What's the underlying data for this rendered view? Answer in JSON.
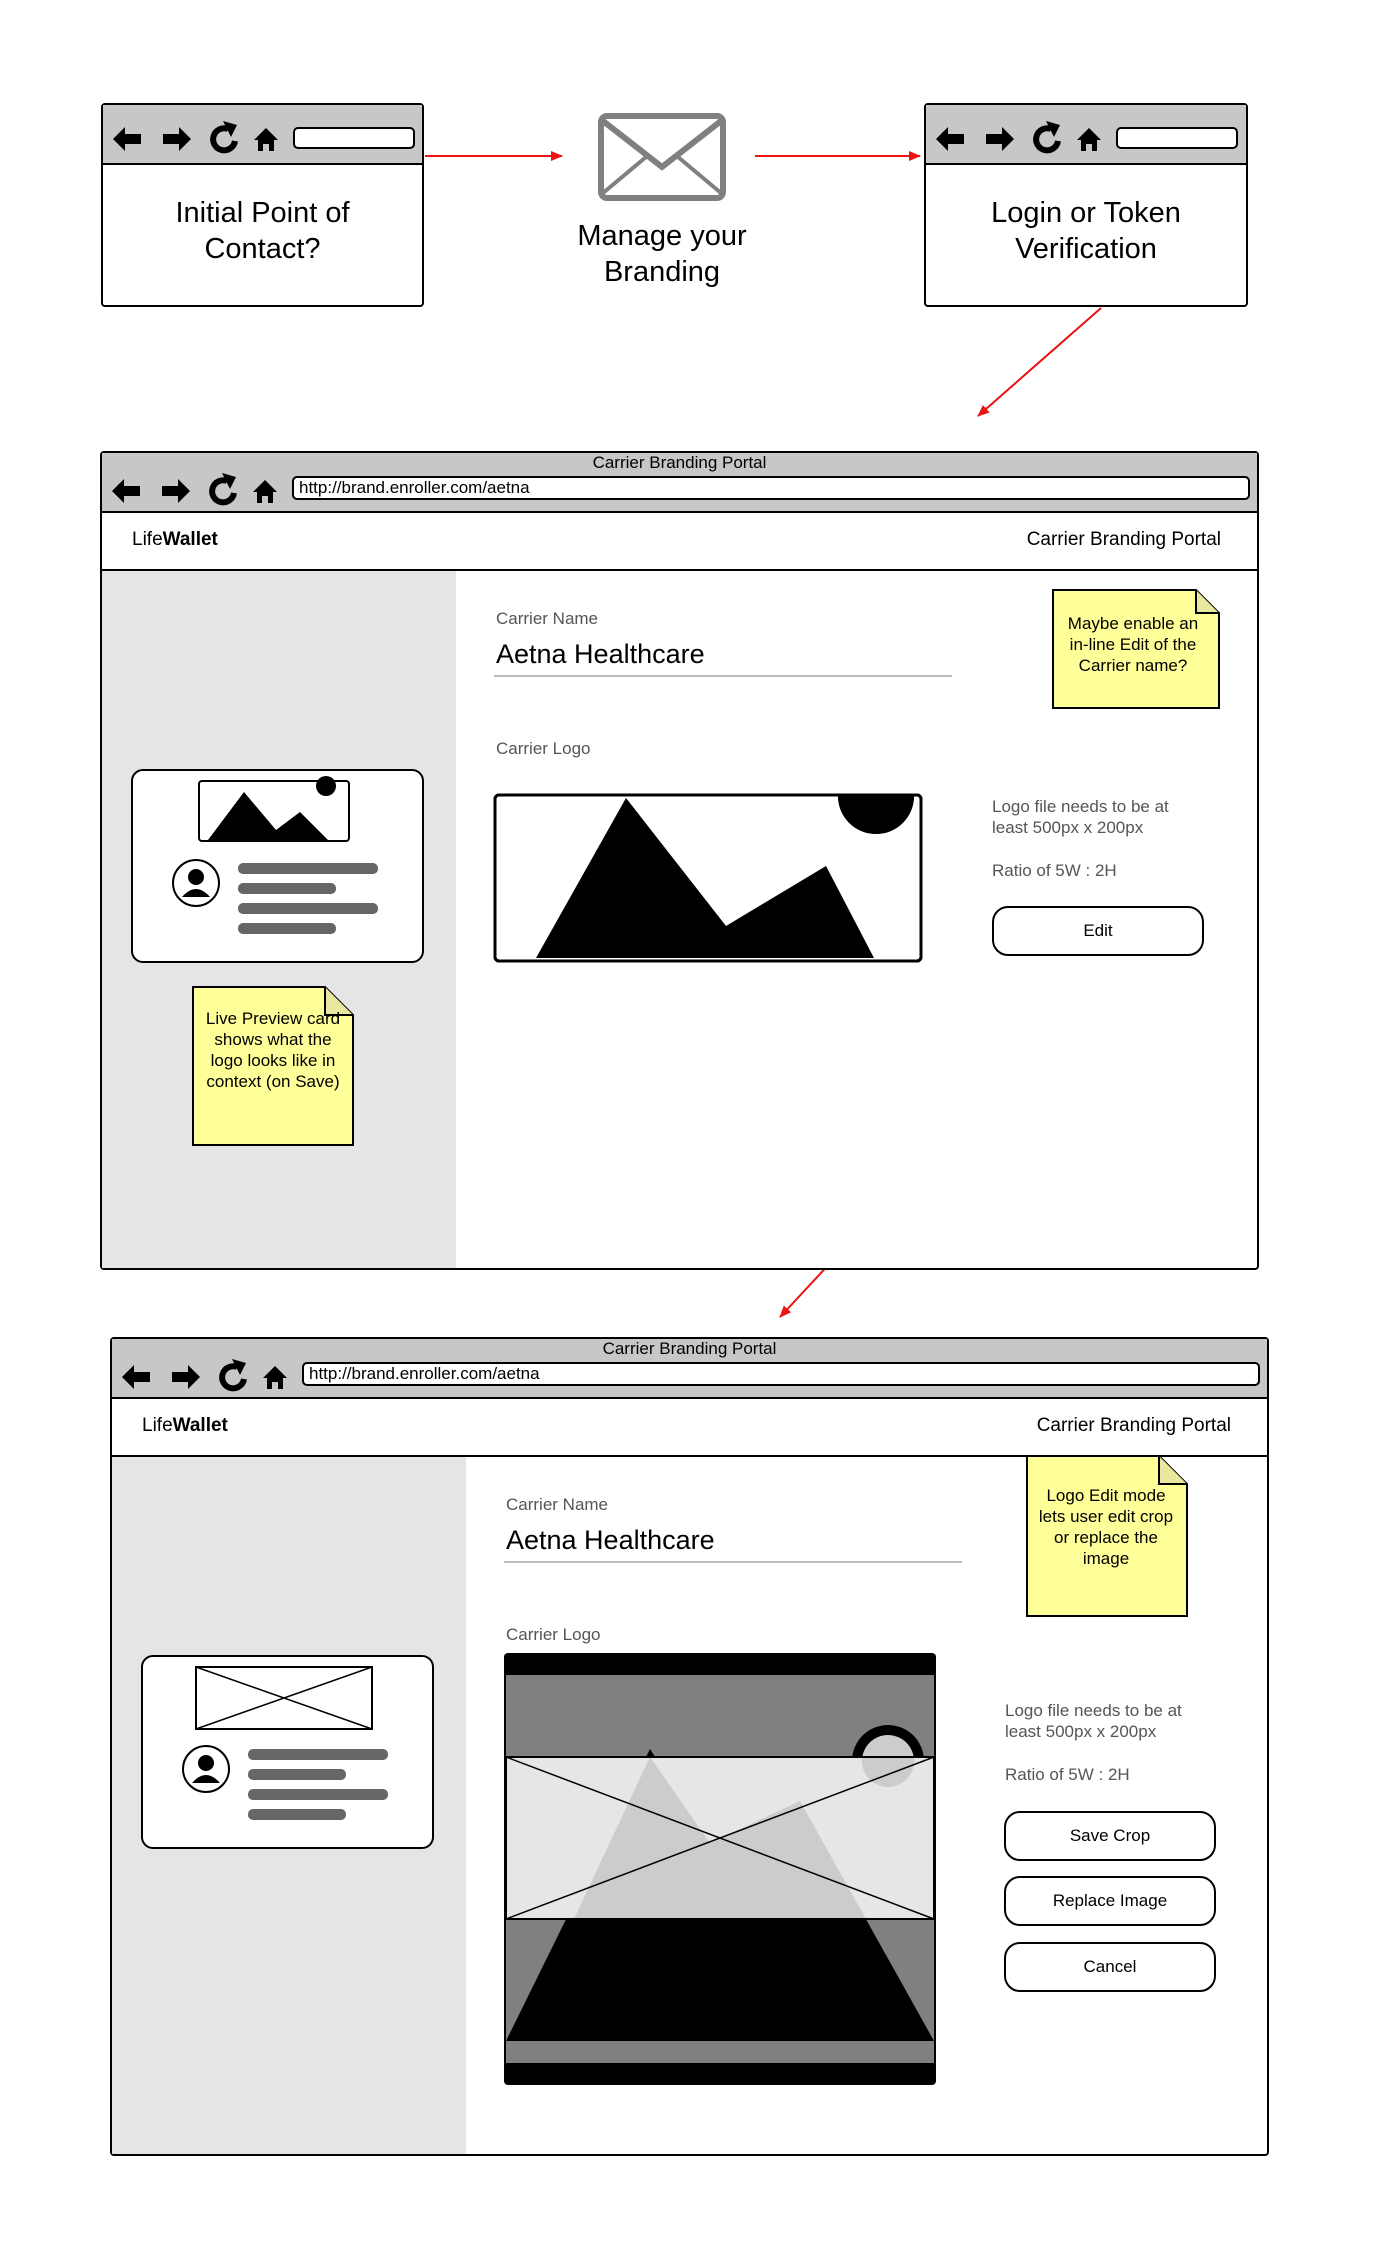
{
  "flow": {
    "initial": "Initial Point of Contact?",
    "manage": "Manage your Branding",
    "login": "Login or Token Verification"
  },
  "screen1": {
    "window_title": "Carrier Branding Portal",
    "url": "http://brand.enroller.com/aetna",
    "brand_prefix": "Life",
    "brand_bold": "Wallet",
    "portal_title": "Carrier Branding Portal",
    "carrier_name_label": "Carrier Name",
    "carrier_name_value": "Aetna Healthcare",
    "carrier_logo_label": "Carrier Logo",
    "hint_size": "Logo file needs to be at least 500px x 200px",
    "hint_ratio": "Ratio of 5W : 2H",
    "edit_button": "Edit",
    "note_inline_edit": "Maybe enable an in-line Edit of the Carrier name?",
    "note_live_preview": "Live Preview card shows what the logo looks like in context (on Save)"
  },
  "screen2": {
    "window_title": "Carrier Branding Portal",
    "url": "http://brand.enroller.com/aetna",
    "brand_prefix": "Life",
    "brand_bold": "Wallet",
    "portal_title": "Carrier Branding Portal",
    "carrier_name_label": "Carrier Name",
    "carrier_name_value": "Aetna Healthcare",
    "carrier_logo_label": "Carrier Logo",
    "hint_size": "Logo file needs to be at least 500px x 200px",
    "hint_ratio": "Ratio of 5W : 2H",
    "save_crop_button": "Save Crop",
    "replace_image_button": "Replace Image",
    "cancel_button": "Cancel",
    "note_edit_mode": "Logo Edit mode lets user edit crop or replace the image"
  },
  "colors": {
    "arrow": "#ee1111",
    "toolbar": "#c7c7c7",
    "sidebar": "#e5e5e5",
    "sticky_note": "#ffff99",
    "icon_gray": "#808080"
  }
}
